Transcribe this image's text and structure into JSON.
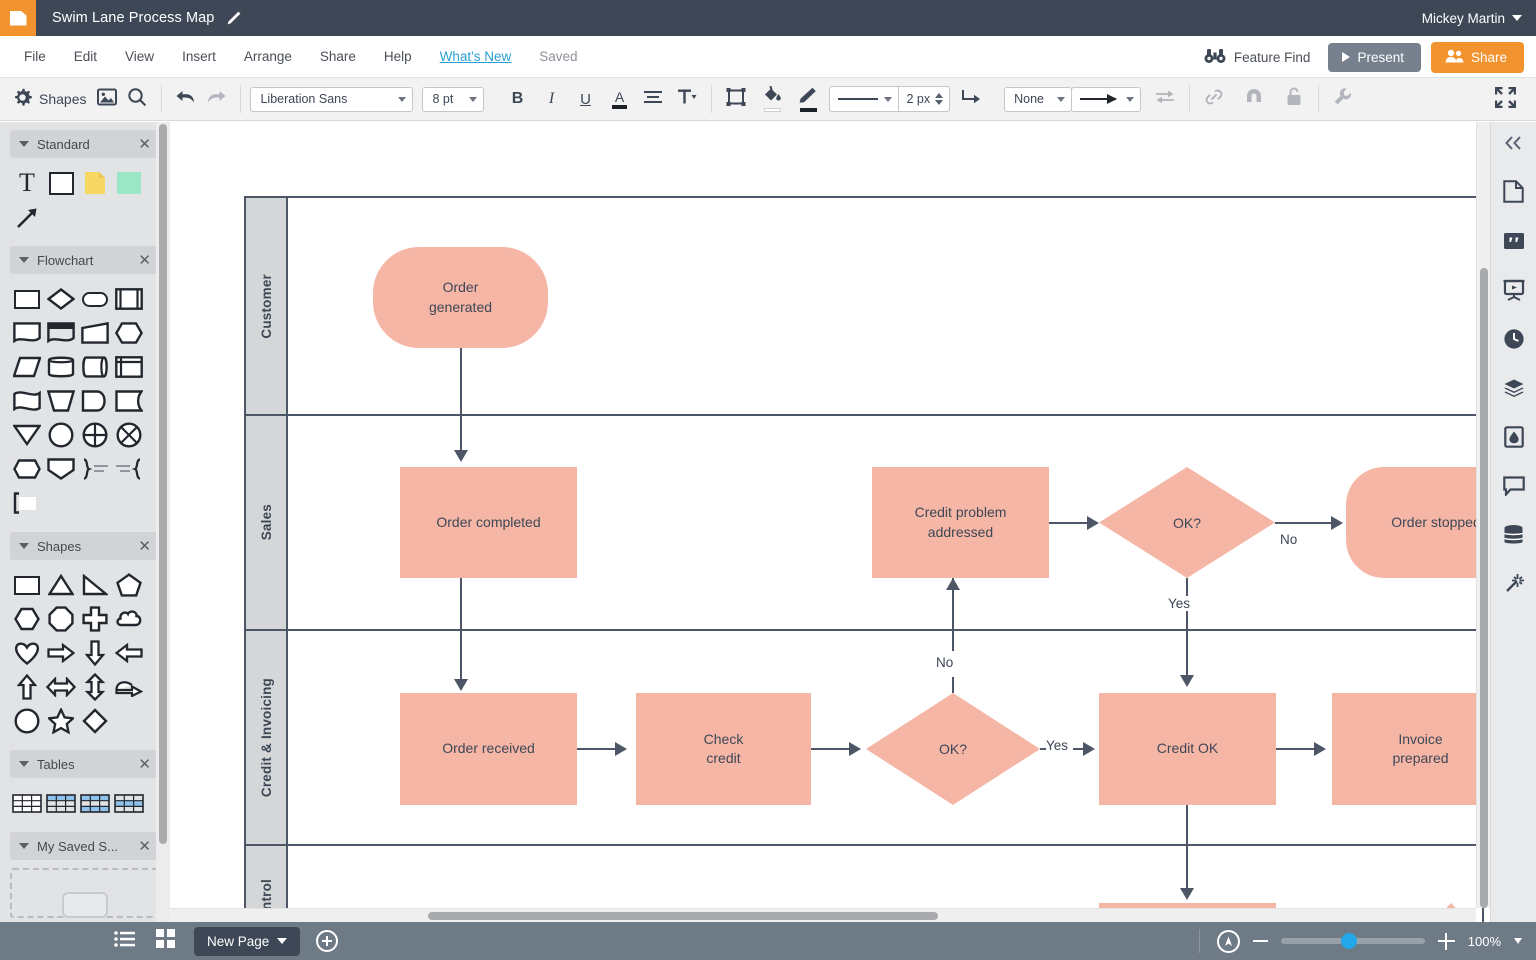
{
  "titlebar": {
    "logo_icon": "folder-icon",
    "document_title": "Swim Lane Process Map",
    "edit_icon": "pencil-icon",
    "user_name": "Mickey Martin"
  },
  "menubar": {
    "items": [
      {
        "label": "File"
      },
      {
        "label": "Edit"
      },
      {
        "label": "View"
      },
      {
        "label": "Insert"
      },
      {
        "label": "Arrange"
      },
      {
        "label": "Share"
      },
      {
        "label": "Help"
      },
      {
        "label": "What's New"
      },
      {
        "label": "Saved"
      }
    ],
    "feature_find_label": "Feature Find",
    "feature_find_icon": "binoculars-icon",
    "present_label": "Present",
    "present_icon": "play-icon",
    "share_label": "Share",
    "share_icon": "people-icon",
    "accent_orange": "#f3932f",
    "present_gray": "#77808d"
  },
  "toolbar": {
    "shapes_label": "Shapes",
    "shapes_icon": "gear-icon",
    "image_icon": "image-icon",
    "search_icon": "search-icon",
    "undo_icon": "undo-icon",
    "redo_icon": "redo-icon",
    "font_family": "Liberation Sans",
    "font_size": "8 pt",
    "bold_label": "B",
    "italic_label": "I",
    "underline_label": "U",
    "text_color_label": "A",
    "align_icon": "align-icon",
    "text_options_label": "T",
    "shape_icon": "shape-icon",
    "fill_icon": "paint-bucket-icon",
    "line_color_icon": "pen-icon",
    "line_style": "line-solid",
    "line_width": "2 px",
    "connector_icon": "elbow-connector-icon",
    "connector_style": "None",
    "arrow_style_icon": "arrow-right-icon",
    "swap_icon": "swap-arrows-icon",
    "link_icon": "link-icon",
    "magnet_icon": "magnet-icon",
    "lock_icon": "lock-icon",
    "wrench_icon": "wrench-icon",
    "fullscreen_icon": "fullscreen-icon"
  },
  "left_panel": {
    "sections": [
      {
        "title": "Standard",
        "close_icon": "close-icon",
        "shapes": [
          "text-shape",
          "rectangle-shape",
          "note-shape",
          "sticky-shape",
          "arrow-shape"
        ]
      },
      {
        "title": "Flowchart",
        "close_icon": "close-icon",
        "shapes": [
          "process-shape",
          "decision-shape",
          "terminator-shape",
          "predefined-process-shape",
          "document-shape",
          "multi-document-shape",
          "manual-input-shape",
          "preparation-shape",
          "data-shape",
          "stored-data-shape",
          "direct-data-shape",
          "internal-storage-shape",
          "paper-tape-shape",
          "manual-operation-shape",
          "display-shape",
          "delay-shape",
          "merge-shape",
          "connector-circle-shape",
          "summing-junction-shape",
          "or-shape",
          "hexagon-shape",
          "extract-shape",
          "right-brace-shape",
          "left-brace-shape",
          "bracket-shape"
        ]
      },
      {
        "title": "Shapes",
        "close_icon": "close-icon",
        "shapes": [
          "rectangle-shape",
          "triangle-shape",
          "right-triangle-shape",
          "pentagon-shape",
          "hexagon-shape",
          "octagon-shape",
          "cross-shape",
          "cloud-shape",
          "heart-shape",
          "arrow-right-shape",
          "arrow-down-shape",
          "arrow-left-shape",
          "arrow-up-shape",
          "arrow-left-right-shape",
          "arrow-up-down-shape",
          "bent-arrow-shape",
          "circle-shape",
          "star-shape",
          "diamond-shape"
        ]
      },
      {
        "title": "Tables",
        "close_icon": "close-icon",
        "shapes": [
          "table-plain",
          "table-header-blue",
          "table-striped",
          "table-banded"
        ]
      },
      {
        "title": "My Saved S...",
        "close_icon": "close-icon",
        "shapes": [
          "saved-shape-placeholder"
        ]
      }
    ]
  },
  "right_rail": {
    "items": [
      {
        "icon": "collapse-chevrons-icon",
        "name": "collapse-panel"
      },
      {
        "icon": "document-icon",
        "name": "document-properties"
      },
      {
        "icon": "quote-icon",
        "name": "notes"
      },
      {
        "icon": "presentation-icon",
        "name": "presentation"
      },
      {
        "icon": "clock-icon",
        "name": "revision-history"
      },
      {
        "icon": "layers-icon",
        "name": "layers"
      },
      {
        "icon": "theme-drop-icon",
        "name": "theme"
      },
      {
        "icon": "comment-icon",
        "name": "comments"
      },
      {
        "icon": "database-icon",
        "name": "data-links"
      },
      {
        "icon": "magic-wand-icon",
        "name": "shape-data"
      }
    ]
  },
  "statusbar": {
    "list_view_icon": "list-view-icon",
    "grid_view_icon": "grid-view-icon",
    "new_page_label": "New Page",
    "add_page_icon": "plus-circle-icon",
    "navigator_icon": "navigator-icon",
    "zoom_out_icon": "minus-icon",
    "zoom_in_icon": "plus-icon",
    "zoom_level": "100%",
    "slider_position_pct": 42
  },
  "chart_data": {
    "type": "diagram",
    "diagram_type": "swimlane-flowchart",
    "title": "Swim Lane Process Map",
    "node_fill": "#f6b6a6",
    "line_color": "#4d5666",
    "lane_header_fill": "#d5d6d8",
    "lanes": [
      {
        "name": "Customer",
        "nodes": [
          {
            "id": "order-generated",
            "label": "Order\ngenerated",
            "shape": "terminator"
          }
        ]
      },
      {
        "name": "Sales",
        "nodes": [
          {
            "id": "order-completed",
            "label": "Order completed",
            "shape": "process"
          },
          {
            "id": "credit-problem-addressed",
            "label": "Credit problem\naddressed",
            "shape": "process"
          },
          {
            "id": "sales-ok",
            "label": "OK?",
            "shape": "decision"
          },
          {
            "id": "order-stopped",
            "label": "Order stopped",
            "shape": "terminator"
          }
        ]
      },
      {
        "name": "Credit & Invoicing",
        "nodes": [
          {
            "id": "order-received",
            "label": "Order received",
            "shape": "process"
          },
          {
            "id": "check-credit",
            "label": "Check\ncredit",
            "shape": "process"
          },
          {
            "id": "credit-ok-decision",
            "label": "OK?",
            "shape": "decision"
          },
          {
            "id": "credit-ok",
            "label": "Credit OK",
            "shape": "process"
          },
          {
            "id": "invoice-prepared",
            "label": "Invoice\nprepared",
            "shape": "process"
          }
        ]
      },
      {
        "name": "Control",
        "nodes": [
          {
            "id": "control-process",
            "label": "",
            "shape": "process"
          },
          {
            "id": "control-triangle",
            "label": "",
            "shape": "triangle"
          }
        ]
      }
    ],
    "edges": [
      {
        "from": "order-generated",
        "to": "order-completed",
        "label": ""
      },
      {
        "from": "order-completed",
        "to": "order-received",
        "label": ""
      },
      {
        "from": "order-received",
        "to": "check-credit",
        "label": ""
      },
      {
        "from": "check-credit",
        "to": "credit-ok-decision",
        "label": ""
      },
      {
        "from": "credit-ok-decision",
        "to": "credit-ok",
        "label": "Yes"
      },
      {
        "from": "credit-ok-decision",
        "to": "credit-problem-addressed",
        "label": "No"
      },
      {
        "from": "credit-problem-addressed",
        "to": "sales-ok",
        "label": ""
      },
      {
        "from": "sales-ok",
        "to": "order-stopped",
        "label": "No"
      },
      {
        "from": "sales-ok",
        "to": "credit-ok",
        "label": "Yes"
      },
      {
        "from": "credit-ok",
        "to": "invoice-prepared",
        "label": ""
      },
      {
        "from": "credit-ok",
        "to": "control-process",
        "label": ""
      }
    ],
    "edge_labels": [
      "Yes",
      "No",
      "Yes",
      "No"
    ]
  }
}
